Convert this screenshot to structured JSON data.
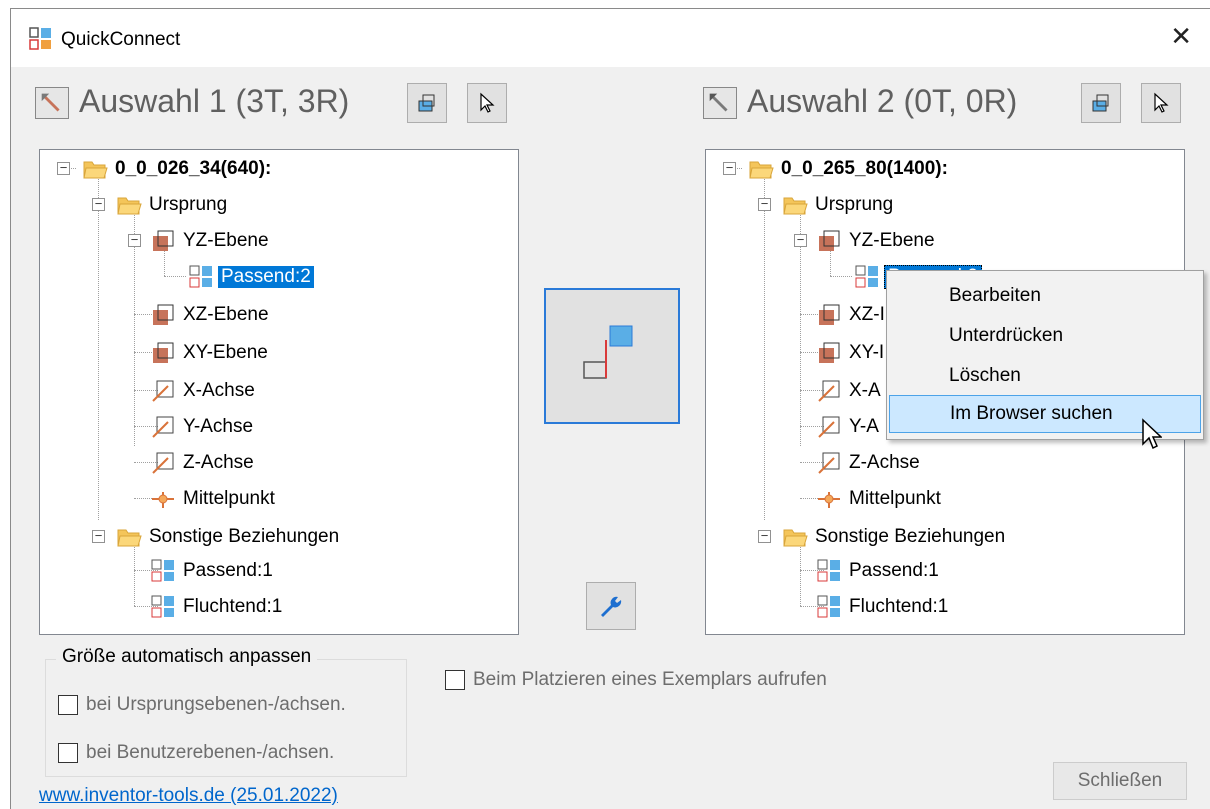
{
  "window": {
    "title": "QuickConnect"
  },
  "left": {
    "title": "Auswahl 1 (3T, 3R)",
    "root": "0_0_026_34(640):",
    "nodes": {
      "ursprung": "Ursprung",
      "yz": "YZ-Ebene",
      "passend2": "Passend:2",
      "xz": "XZ-Ebene",
      "xy": "XY-Ebene",
      "xachse": "X-Achse",
      "yachse": "Y-Achse",
      "zachse": "Z-Achse",
      "mittel": "Mittelpunkt",
      "sonstige": "Sonstige Beziehungen",
      "passend1": "Passend:1",
      "fluchtend1": "Fluchtend:1"
    }
  },
  "right": {
    "title": "Auswahl 2 (0T, 0R)",
    "root": "0_0_265_80(1400):",
    "nodes": {
      "ursprung": "Ursprung",
      "yz": "YZ-Ebene",
      "passend2": "Passend:2",
      "xz": "XZ-I",
      "xy": "XY-I",
      "xachse": "X-A",
      "yachse": "Y-A",
      "zachse": "Z-Achse",
      "mittel": "Mittelpunkt",
      "sonstige": "Sonstige Beziehungen",
      "passend1": "Passend:1",
      "fluchtend1": "Fluchtend:1"
    }
  },
  "context_menu": {
    "items": [
      "Bearbeiten",
      "Unterdrücken",
      "Löschen",
      "Im Browser suchen"
    ],
    "highlighted_index": 3
  },
  "options": {
    "group_title": "Größe automatisch anpassen",
    "cb_origin": "bei Ursprungsebenen-/achsen.",
    "cb_user": "bei Benutzerebenen-/achsen.",
    "cb_place": "Beim Platzieren eines Exemplars aufrufen"
  },
  "footer": {
    "link": "www.inventor-tools.de (25.01.2022)",
    "close_button": "Schließen"
  },
  "colors": {
    "accent": "#0078d7",
    "folder": "#f4c55a",
    "plane": "#c7735a",
    "constraint_blue": "#5aaee6",
    "constraint_red": "#d93a3a"
  }
}
